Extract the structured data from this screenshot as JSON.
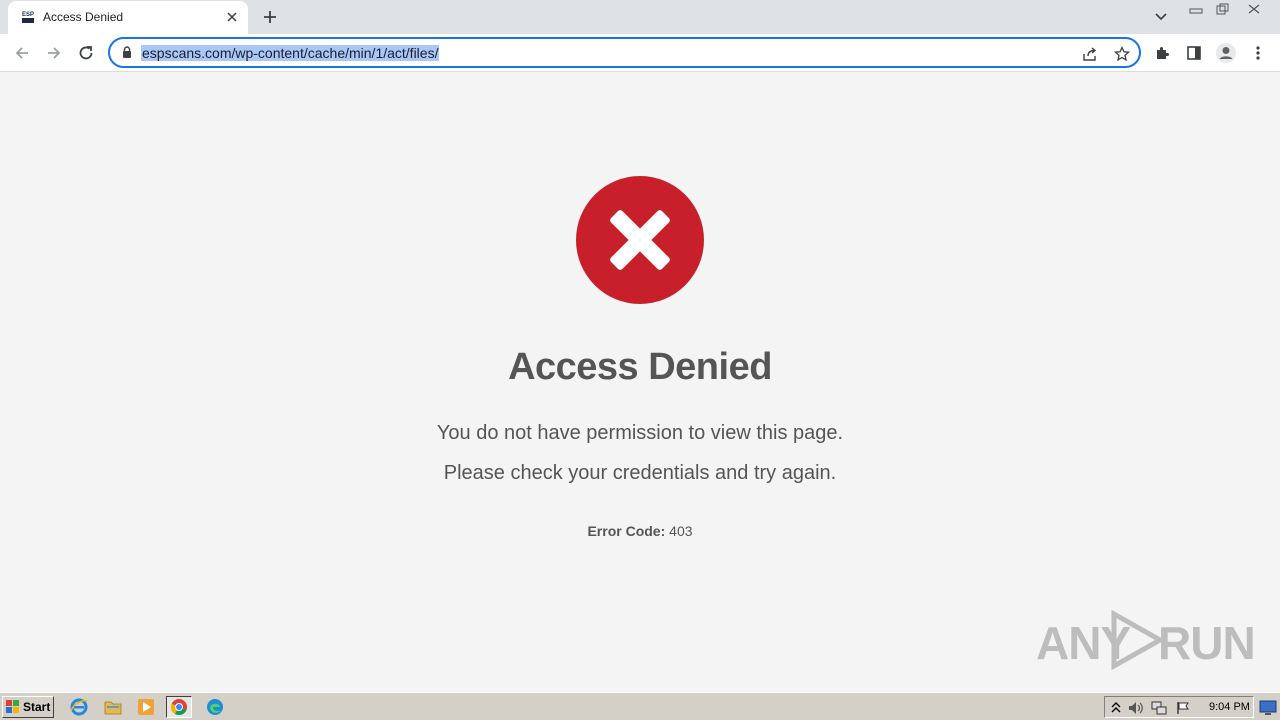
{
  "browser": {
    "tab": {
      "title": "Access Denied",
      "favicon": "espscans-favicon"
    },
    "url": "espscans.com/wp-content/cache/min/1/act/files/",
    "accent": "#1a73e8",
    "url_highlight": "#a8c7fa"
  },
  "page": {
    "icon": "red-x-circle-icon",
    "icon_color": "#c8202a",
    "heading": "Access Denied",
    "message_line1": "You do not have permission to view this page.",
    "message_line2": "Please check your credentials and try again.",
    "error_label": "Error Code:",
    "error_value": "403",
    "text_color": "#555555",
    "background": "#f4f4f4"
  },
  "watermark": {
    "left": "ANY",
    "right": "RUN"
  },
  "taskbar": {
    "start_label": "Start",
    "apps": [
      "internet-explorer-icon",
      "file-explorer-icon",
      "media-player-icon",
      "chrome-icon",
      "edge-icon"
    ],
    "clock": "9:04 PM"
  }
}
